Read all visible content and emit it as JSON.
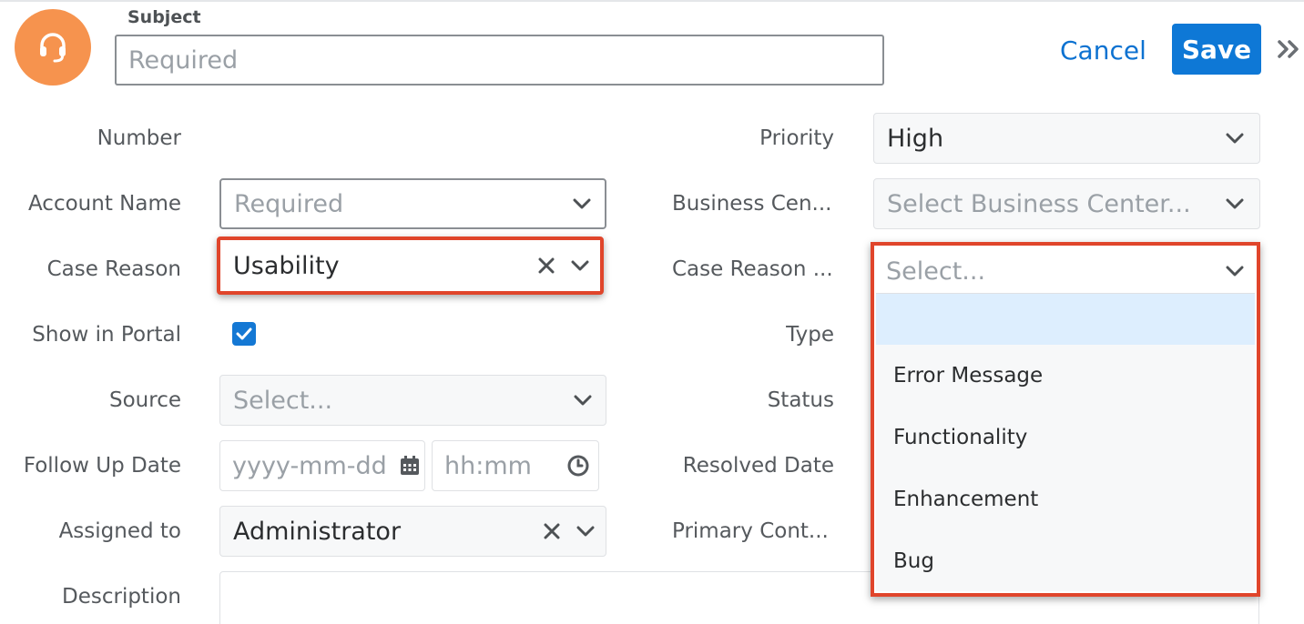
{
  "header": {
    "subject_label": "Subject",
    "subject_placeholder": "Required",
    "cancel_label": "Cancel",
    "save_label": "Save",
    "avatar_icon": "headset-icon",
    "more_icon": "double-chevron-right-icon",
    "avatar_color": "#f6934e",
    "accent_color": "#0e78d6"
  },
  "left_fields": {
    "number": {
      "label": "Number"
    },
    "account_name": {
      "label": "Account Name",
      "placeholder": "Required"
    },
    "case_reason": {
      "label": "Case Reason",
      "value": "Usability"
    },
    "show_in_portal": {
      "label": "Show in Portal",
      "checked": true
    },
    "source": {
      "label": "Source",
      "placeholder": "Select..."
    },
    "follow_up_date": {
      "label": "Follow Up Date",
      "date_placeholder": "yyyy-mm-dd",
      "time_placeholder": "hh:mm"
    },
    "assigned_to": {
      "label": "Assigned to",
      "value": "Administrator"
    },
    "description": {
      "label": "Description"
    }
  },
  "right_fields": {
    "priority": {
      "label": "Priority",
      "value": "High"
    },
    "business_center": {
      "label": "Business Cen...",
      "placeholder": "Select Business Center..."
    },
    "case_reason_detail": {
      "label": "Case Reason ...",
      "placeholder": "Select..."
    },
    "type": {
      "label": "Type"
    },
    "status": {
      "label": "Status"
    },
    "resolved_date": {
      "label": "Resolved Date"
    },
    "primary_contact": {
      "label": "Primary Cont..."
    }
  },
  "dropdown": {
    "options": [
      "",
      "Error Message",
      "Functionality",
      "Enhancement",
      "Bug"
    ],
    "active_index": 0
  },
  "highlight_color": "#e0452b"
}
